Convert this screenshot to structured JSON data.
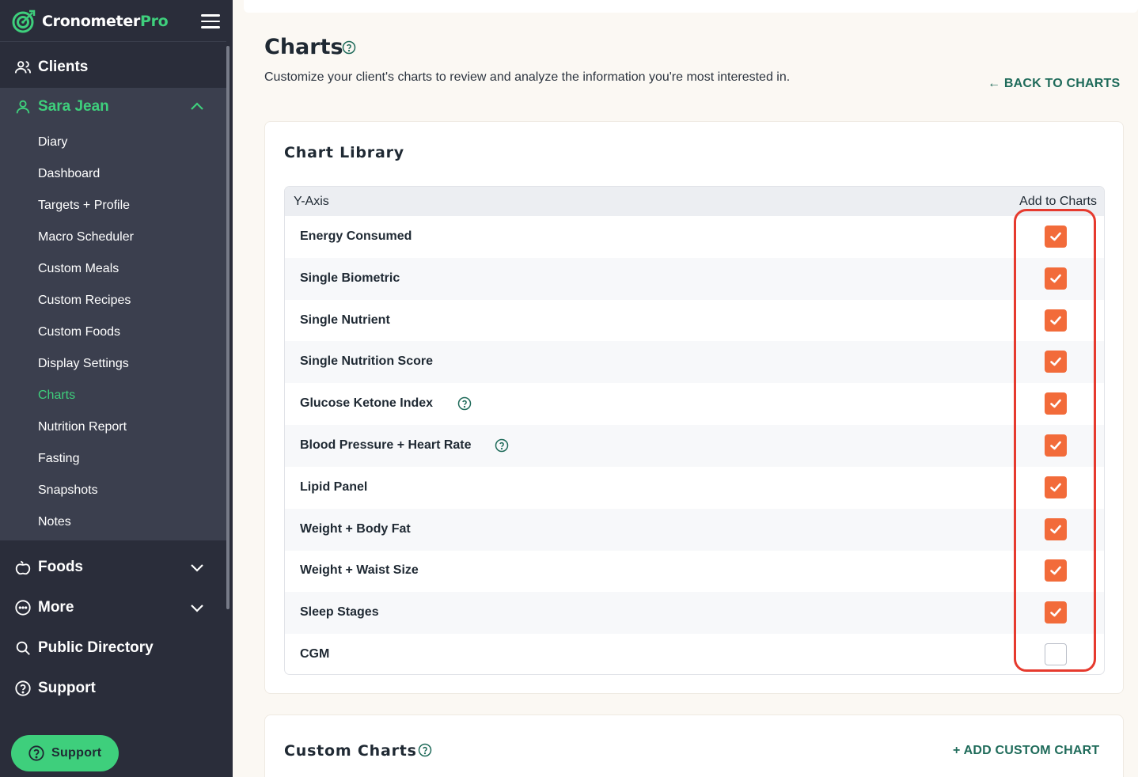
{
  "app": {
    "brand_name": "Cronometer",
    "brand_suffix": "Pro"
  },
  "sidebar": {
    "clients_label": "Clients",
    "client_name": "Sara Jean",
    "client_items": [
      {
        "label": "Diary"
      },
      {
        "label": "Dashboard"
      },
      {
        "label": "Targets + Profile"
      },
      {
        "label": "Macro Scheduler"
      },
      {
        "label": "Custom Meals"
      },
      {
        "label": "Custom Recipes"
      },
      {
        "label": "Custom Foods"
      },
      {
        "label": "Display Settings"
      },
      {
        "label": "Charts",
        "active": true
      },
      {
        "label": "Nutrition Report"
      },
      {
        "label": "Fasting"
      },
      {
        "label": "Snapshots"
      },
      {
        "label": "Notes"
      }
    ],
    "main_items": [
      {
        "label": "Foods",
        "icon": "apple-icon"
      },
      {
        "label": "More",
        "icon": "more-dots-icon"
      },
      {
        "label": "Public Directory",
        "icon": "search-icon"
      },
      {
        "label": "Support",
        "icon": "help-circle-icon"
      }
    ],
    "support_button": "Support"
  },
  "page": {
    "title": "Charts",
    "description": "Customize your client's charts to review and analyze the information you're most interested in.",
    "back_link": "← BACK TO CHARTS"
  },
  "chart_library": {
    "title": "Chart Library",
    "col_yaxis": "Y-Axis",
    "col_add": "Add to Charts",
    "rows": [
      {
        "label": "Energy Consumed",
        "checked": true,
        "help": false
      },
      {
        "label": "Single Biometric",
        "checked": true,
        "help": false
      },
      {
        "label": "Single Nutrient",
        "checked": true,
        "help": false
      },
      {
        "label": "Single Nutrition Score",
        "checked": true,
        "help": false
      },
      {
        "label": "Glucose Ketone Index",
        "checked": true,
        "help": true
      },
      {
        "label": "Blood Pressure + Heart Rate",
        "checked": true,
        "help": true
      },
      {
        "label": "Lipid Panel",
        "checked": true,
        "help": false
      },
      {
        "label": "Weight + Body Fat",
        "checked": true,
        "help": false
      },
      {
        "label": "Weight + Waist Size",
        "checked": true,
        "help": false
      },
      {
        "label": "Sleep Stages",
        "checked": true,
        "help": false
      },
      {
        "label": "CGM",
        "checked": false,
        "help": false
      }
    ]
  },
  "custom_charts": {
    "title": "Custom Charts",
    "add_link": "+ ADD CUSTOM CHART"
  },
  "colors": {
    "sidebar_bg": "#2a2d3a",
    "accent_green": "#3ecf7c",
    "checkbox_orange": "#f26b3a",
    "link_teal": "#1f6b5a",
    "highlight_red": "#e63a2e"
  }
}
